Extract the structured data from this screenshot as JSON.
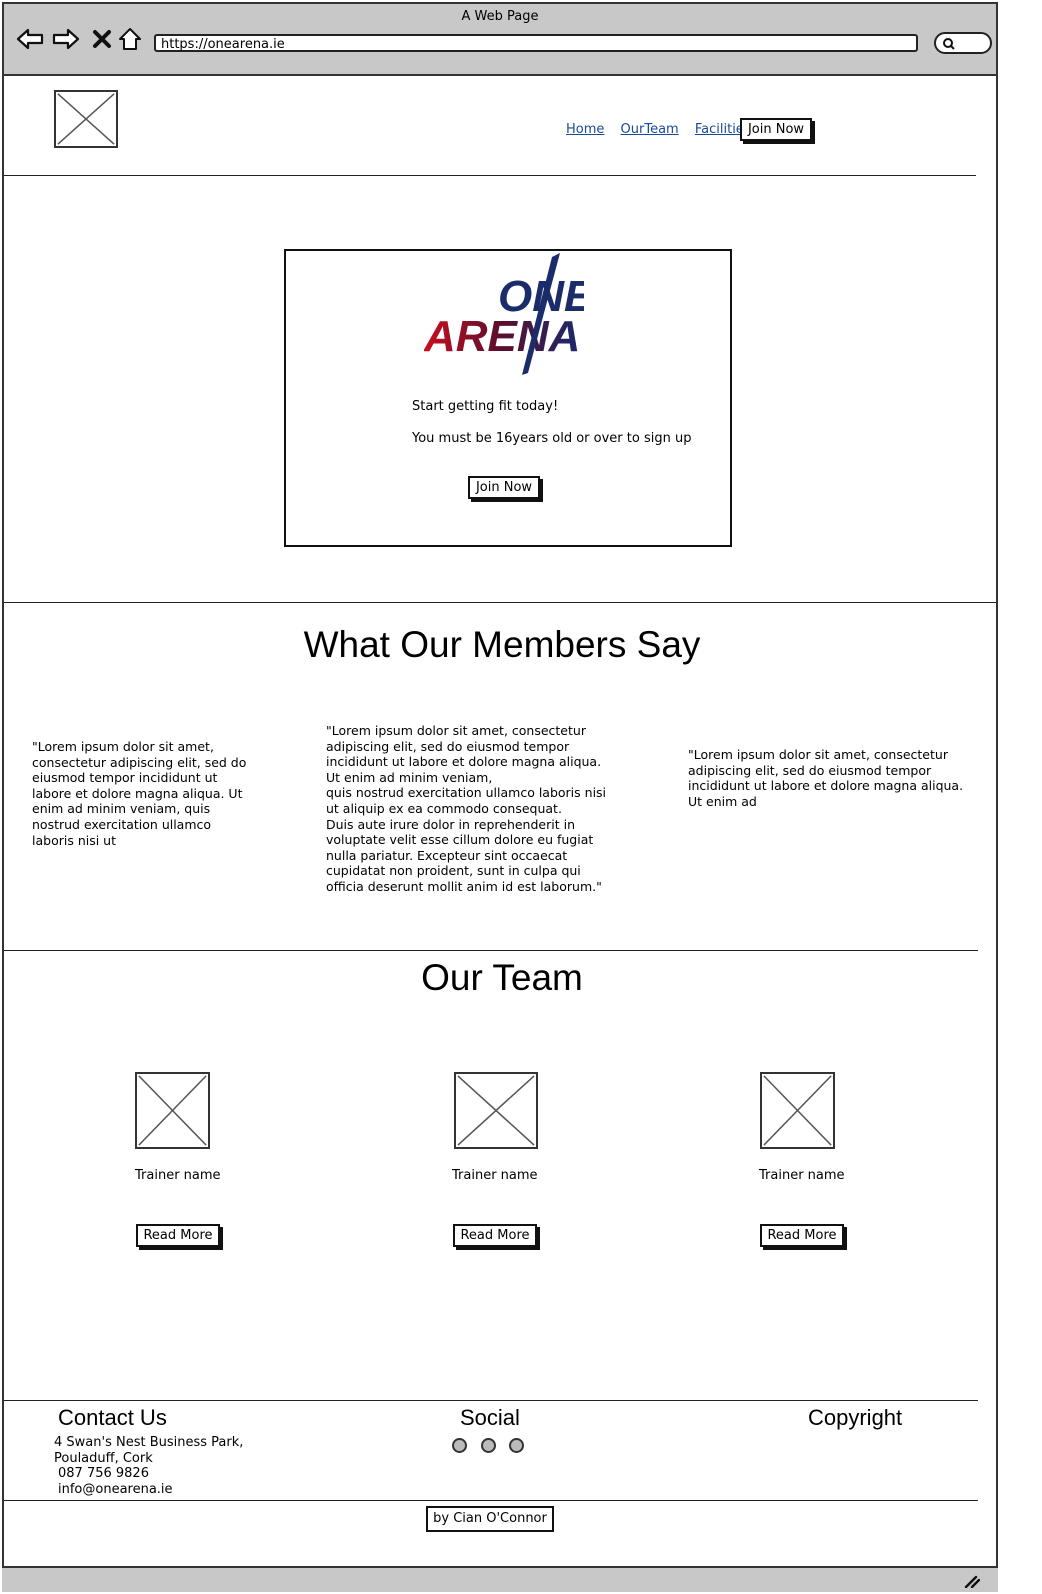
{
  "browser": {
    "window_title": "A Web Page",
    "url": "https://onearena.ie"
  },
  "header": {
    "nav": [
      {
        "label": "Home"
      },
      {
        "label": "OurTeam"
      },
      {
        "label": "Facilities"
      }
    ],
    "join_label": "Join Now"
  },
  "hero": {
    "logo": {
      "line1": "ONE",
      "line2": "ARENA"
    },
    "line1": "Start getting fit today!",
    "line2": "You must be 16years old or over to sign up",
    "join_label": "Join Now"
  },
  "testimonials": {
    "title": "What Our Members Say",
    "quotes": [
      "\"Lorem ipsum dolor sit amet, consectetur adipiscing elit, sed do eiusmod tempor incididunt ut labore et dolore magna aliqua. Ut enim ad minim veniam, quis nostrud exercitation ullamco laboris nisi ut",
      "\"Lorem ipsum dolor sit amet, consectetur adipiscing elit, sed do eiusmod tempor incididunt ut labore et dolore magna aliqua. Ut enim ad minim veniam,\nquis nostrud exercitation ullamco laboris nisi ut aliquip ex ea commodo consequat.\nDuis aute irure dolor in reprehenderit in voluptate velit esse cillum dolore eu fugiat nulla pariatur. Excepteur sint occaecat cupidatat non proident, sunt in culpa qui officia deserunt mollit anim id est laborum.\"",
      "\"Lorem ipsum dolor sit amet, consectetur adipiscing elit, sed do eiusmod tempor incididunt ut labore et dolore magna aliqua. Ut enim ad"
    ]
  },
  "team": {
    "title": "Our Team",
    "trainers": [
      {
        "name": "Trainer name",
        "button": "Read More"
      },
      {
        "name": "Trainer name",
        "button": "Read More"
      },
      {
        "name": "Trainer name",
        "button": "Read More"
      }
    ]
  },
  "footer": {
    "contact_title": "Contact Us",
    "address_line1": "4 Swan's Nest Business Park,",
    "address_line2": "Pouladuff, Cork",
    "phone": "087 756 9826",
    "email": "info@onearena.ie",
    "social_title": "Social",
    "copyright_title": "Copyright",
    "credit": "by Cian O'Connor"
  }
}
